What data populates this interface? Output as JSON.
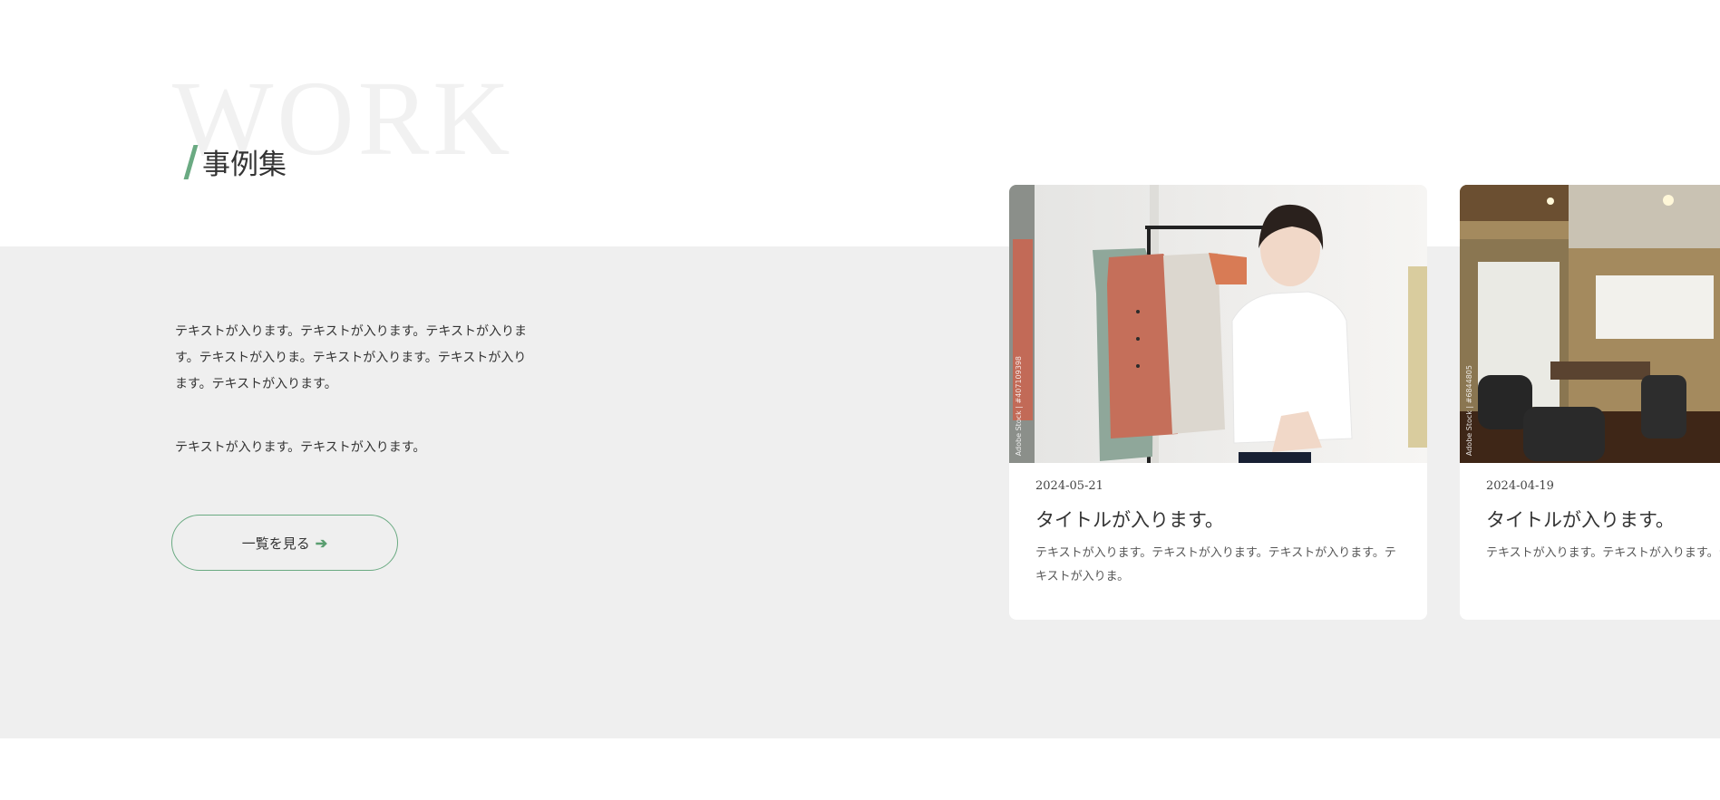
{
  "section": {
    "bg_word": "WORK",
    "title": "事例集",
    "lead_text": "テキストが入ります。テキストが入ります。テキストが入ります。テキストが入りま。テキストが入ります。テキストが入ります。テキストが入ります。",
    "lead_text_2": "テキストが入ります。テキストが入ります。",
    "view_all_label": "一覧を見る",
    "view_all_arrow": "➔",
    "accent_color": "#6aaa82",
    "band_color": "#efefef"
  },
  "cards": [
    {
      "image_credit": "Adobe Stock | #407109398",
      "date": "2024-05-21",
      "title": "タイトルが入ります。",
      "text": "テキストが入ります。テキストが入ります。テキストが入ります。テキストが入りま。"
    },
    {
      "image_credit": "Adobe Stock | #6844805",
      "date": "2024-04-19",
      "title": "タイトルが入ります。",
      "text": "テキストが入ります。テキストが入ります。テキストが入りま。"
    }
  ]
}
